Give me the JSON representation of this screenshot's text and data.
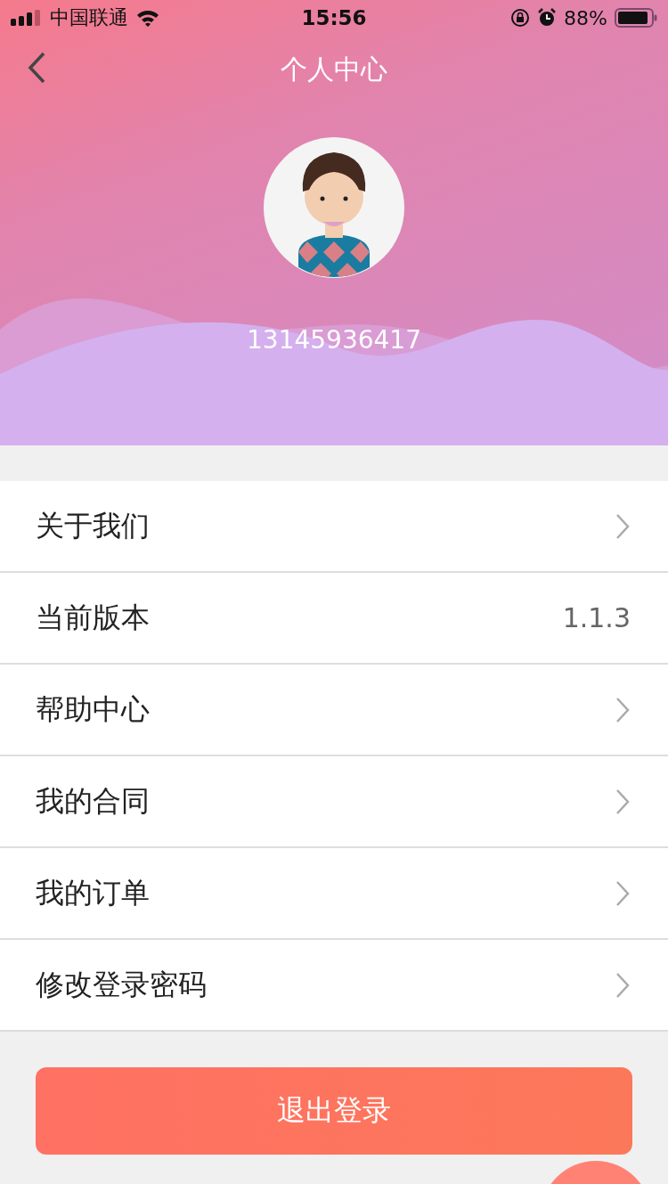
{
  "status_bar": {
    "carrier": "中国联通",
    "time": "15:56",
    "battery": "88%"
  },
  "nav": {
    "title": "个人中心"
  },
  "profile": {
    "phone": "13145936417"
  },
  "menu": [
    {
      "label": "关于我们",
      "kind": "link"
    },
    {
      "label": "当前版本",
      "kind": "value",
      "value": "1.1.3"
    },
    {
      "label": "帮助中心",
      "kind": "link"
    },
    {
      "label": "我的合同",
      "kind": "link"
    },
    {
      "label": "我的订单",
      "kind": "link"
    },
    {
      "label": "修改登录密码",
      "kind": "link"
    }
  ],
  "logout_button": "退出登录"
}
